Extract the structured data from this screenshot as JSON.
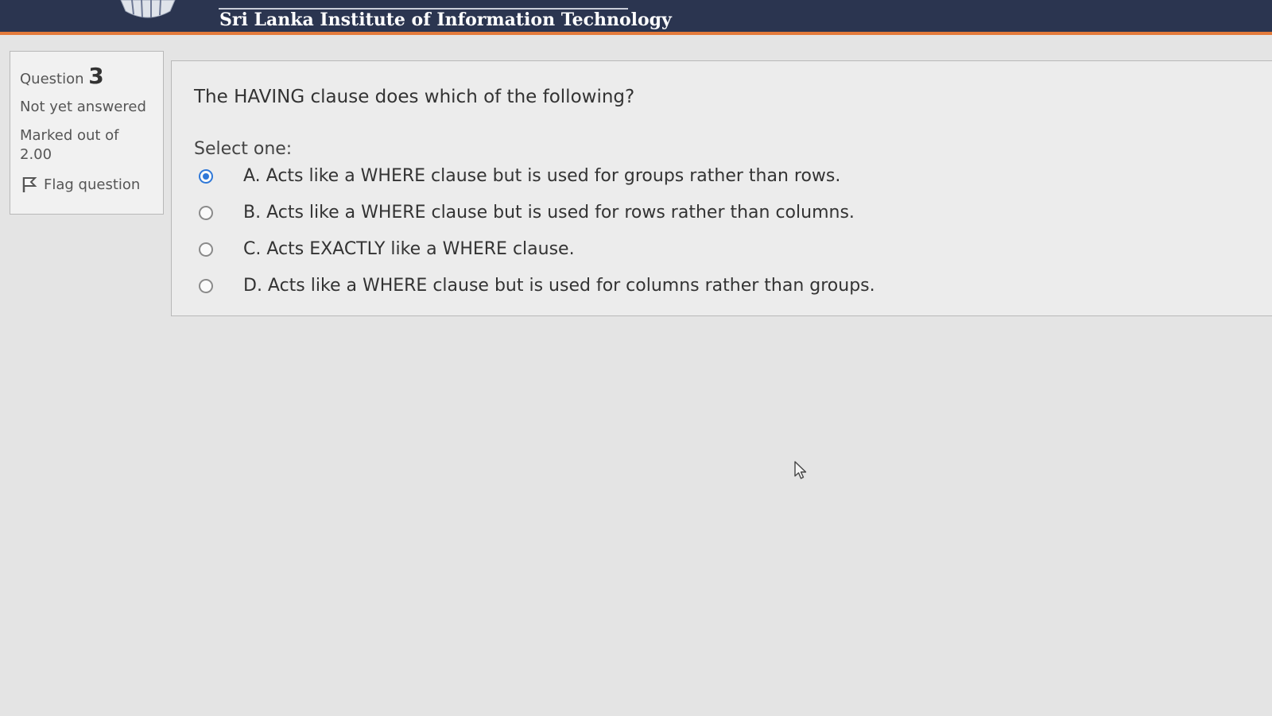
{
  "header": {
    "site_name": "Sri Lanka Institute of Information Technology"
  },
  "question_info": {
    "label": "Question",
    "number": "3",
    "status": "Not yet answered",
    "marked_out_of": "Marked out of 2.00",
    "flag_label": "Flag question"
  },
  "question": {
    "text": "The HAVING clause does which of the following?",
    "prompt": "Select one:",
    "options": [
      {
        "label": "A. Acts like a WHERE clause but is used for groups rather than rows.",
        "selected": true
      },
      {
        "label": "B. Acts like a WHERE clause but is used for rows rather than columns.",
        "selected": false
      },
      {
        "label": "C. Acts EXACTLY like a WHERE clause.",
        "selected": false
      },
      {
        "label": "D. Acts like a WHERE clause but is used for columns rather than groups.",
        "selected": false
      }
    ]
  },
  "icons": {
    "logo": "university-crest-icon",
    "flag": "flag-icon",
    "cursor": "mouse-pointer-icon"
  },
  "colors": {
    "header_bg": "#2b3550",
    "header_accent": "#e37a3b",
    "radio_selected": "#2f78d8"
  }
}
